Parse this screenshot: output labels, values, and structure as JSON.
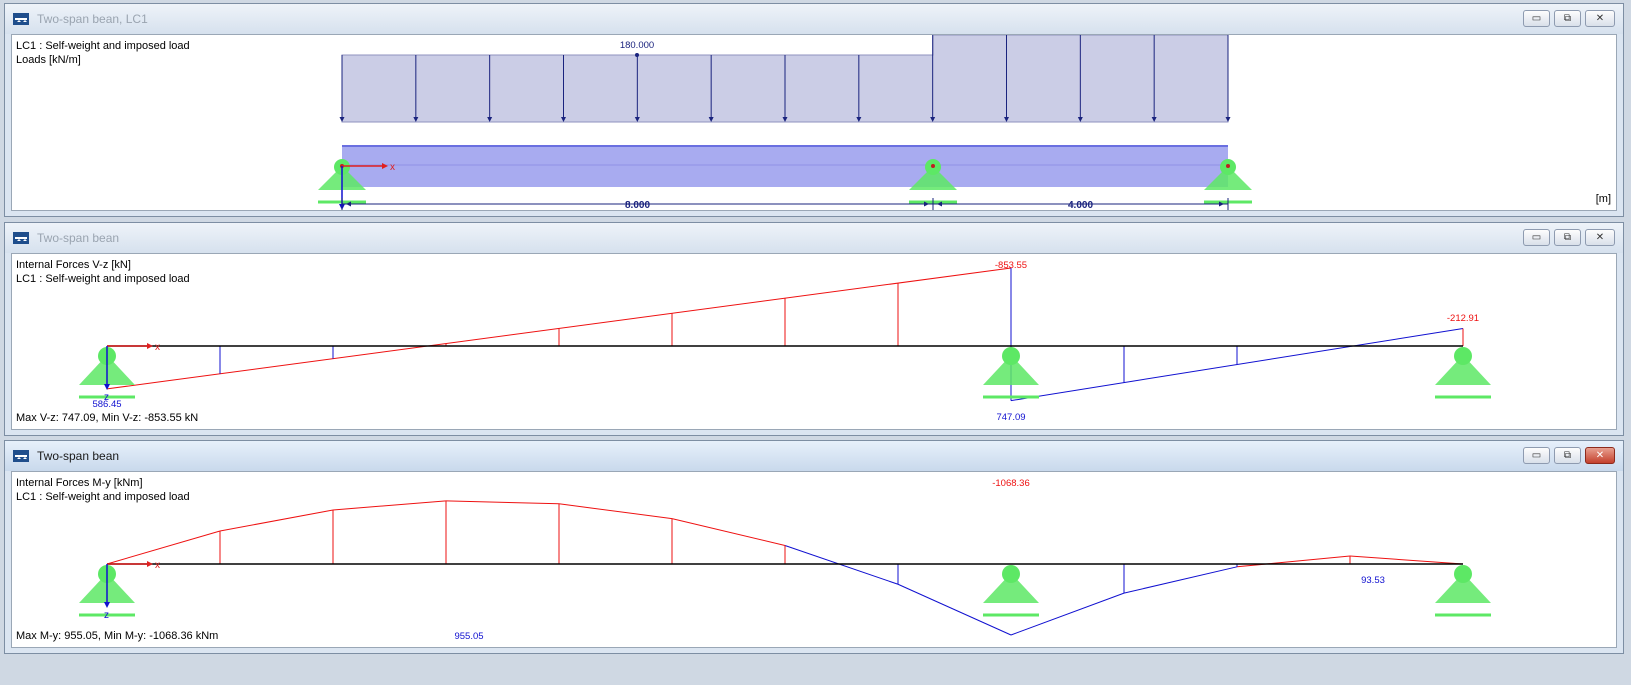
{
  "colors": {
    "positive": "#1010d0",
    "negative": "#ee1111",
    "support": "#5de865",
    "load_fill": "#cbcde6",
    "member_fill": "#9ea2ee",
    "dimension": "#1a237e"
  },
  "icons": {
    "app": "beam-app-icon",
    "minimize": "minimize-icon",
    "maximize": "maximize-icon",
    "close": "close-icon"
  },
  "windows": [
    {
      "title": "Two-span bean, LC1",
      "active": false,
      "info": [
        "LC1 : Self-weight and imposed load",
        "Loads [kN/m]"
      ],
      "load_value": "180.000",
      "axis_x": "x",
      "axis_z": "z",
      "dims": [
        "8.000",
        "4.000"
      ],
      "unit": "[m]"
    },
    {
      "title": "Two-span bean",
      "active": false,
      "info": [
        "Internal Forces V-z [kN]",
        "LC1 : Self-weight and imposed load"
      ],
      "axis_x": "x",
      "axis_z": "z",
      "labels": [
        "586.45",
        "-853.55",
        "747.09",
        "-212.91"
      ],
      "summary": "Max V-z: 747.09, Min V-z: -853.55 kN"
    },
    {
      "title": "Two-span bean",
      "active": true,
      "info": [
        "Internal Forces M-y [kNm]",
        "LC1 : Self-weight and imposed load"
      ],
      "axis_x": "x",
      "axis_z": "z",
      "labels": [
        "955.05",
        "-1068.36",
        "93.53"
      ],
      "summary": "Max M-y: 955.05, Min M-y: -1068.36 kNm"
    }
  ]
}
